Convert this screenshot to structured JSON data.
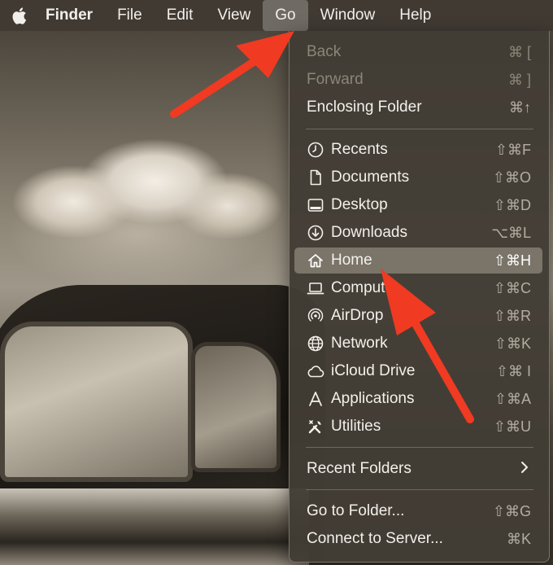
{
  "menubar": {
    "apple_icon": "apple-logo-icon",
    "app_name": "Finder",
    "items": [
      "File",
      "Edit",
      "View",
      "Go",
      "Window",
      "Help"
    ],
    "active": "Go"
  },
  "go_menu": {
    "back": {
      "label": "Back",
      "shortcut": "⌘ ["
    },
    "forward": {
      "label": "Forward",
      "shortcut": "⌘ ]"
    },
    "enclosing": {
      "label": "Enclosing Folder",
      "shortcut": "⌘↑"
    },
    "places": [
      {
        "label": "Recents",
        "shortcut": "⇧⌘F",
        "icon": "clock-icon"
      },
      {
        "label": "Documents",
        "shortcut": "⇧⌘O",
        "icon": "document-icon"
      },
      {
        "label": "Desktop",
        "shortcut": "⇧⌘D",
        "icon": "desktop-icon"
      },
      {
        "label": "Downloads",
        "shortcut": "⌥⌘L",
        "icon": "download-icon"
      },
      {
        "label": "Home",
        "shortcut": "⇧⌘H",
        "icon": "house-icon"
      },
      {
        "label": "Computer",
        "shortcut": "⇧⌘C",
        "icon": "laptop-icon"
      },
      {
        "label": "AirDrop",
        "shortcut": "⇧⌘R",
        "icon": "airdrop-icon"
      },
      {
        "label": "Network",
        "shortcut": "⇧⌘K",
        "icon": "globe-icon"
      },
      {
        "label": "iCloud Drive",
        "shortcut": "⇧⌘ I",
        "icon": "cloud-icon"
      },
      {
        "label": "Applications",
        "shortcut": "⇧⌘A",
        "icon": "applications-icon"
      },
      {
        "label": "Utilities",
        "shortcut": "⇧⌘U",
        "icon": "tools-icon"
      }
    ],
    "recent_folders": {
      "label": "Recent Folders",
      "icon": "chevron-right-icon"
    },
    "go_to_folder": {
      "label": "Go to Folder...",
      "shortcut": "⇧⌘G"
    },
    "connect_server": {
      "label": "Connect to Server...",
      "shortcut": "⌘K"
    }
  },
  "colors": {
    "menubar": "#403a33",
    "menu_bg": "#423c34",
    "highlight": "#7a7469",
    "arrow": "#f03a22"
  }
}
